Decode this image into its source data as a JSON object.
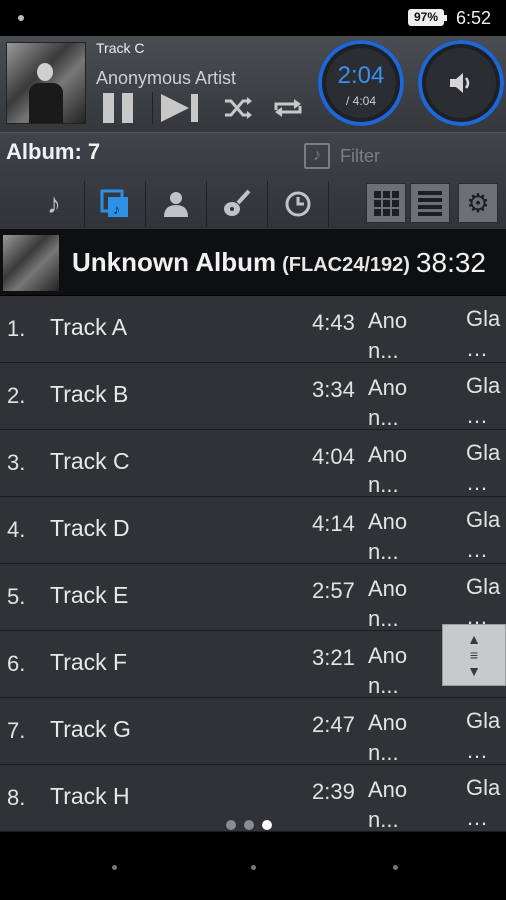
{
  "status_bar": {
    "battery": "97%",
    "time": "6:52"
  },
  "now_playing": {
    "title": "Track C",
    "artist": "Anonymous Artist",
    "current_time": "2:04",
    "total_time": "/ 4:04",
    "accent_color": "#1f66d6"
  },
  "album_bar": {
    "album_count": "Album: 7",
    "filter_label": "Filter",
    "tabs": [
      "songs-tab",
      "albums-tab",
      "artists-tab",
      "genres-tab",
      "recent-tab"
    ],
    "active_tab": "albums-tab"
  },
  "album_header": {
    "title": "Unknown Album",
    "format": "(FLAC24/192)",
    "duration": "38:32"
  },
  "tracks": [
    {
      "num": "1.",
      "name": "Track A",
      "duration": "4:43",
      "artist": "Ano\nn...",
      "genre": "Gla\n…"
    },
    {
      "num": "2.",
      "name": "Track B",
      "duration": "3:34",
      "artist": "Ano\nn...",
      "genre": "Gla\n…"
    },
    {
      "num": "3.",
      "name": "Track C",
      "duration": "4:04",
      "artist": "Ano\nn...",
      "genre": "Gla\n…"
    },
    {
      "num": "4.",
      "name": "Track D",
      "duration": "4:14",
      "artist": "Ano\nn...",
      "genre": "Gla\n…"
    },
    {
      "num": "5.",
      "name": "Track E",
      "duration": "2:57",
      "artist": "Ano\nn...",
      "genre": "Gla\n…"
    },
    {
      "num": "6.",
      "name": "Track F",
      "duration": "3:21",
      "artist": "Ano\nn...",
      "genre": ""
    },
    {
      "num": "7.",
      "name": "Track G",
      "duration": "2:47",
      "artist": "Ano\nn...",
      "genre": "Gla\n…"
    },
    {
      "num": "8.",
      "name": "Track H",
      "duration": "2:39",
      "artist": "Ano\nn...",
      "genre": "Gla\n…"
    }
  ]
}
